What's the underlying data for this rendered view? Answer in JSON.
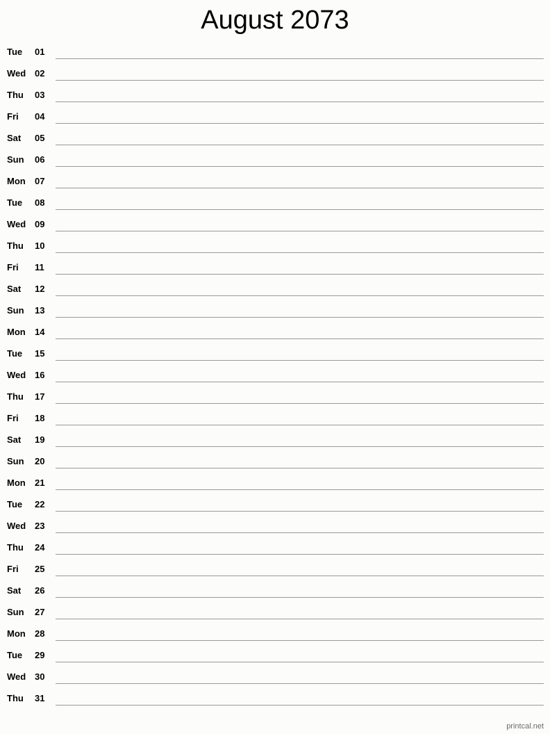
{
  "title": "August 2073",
  "days": [
    {
      "dow": "Tue",
      "num": "01"
    },
    {
      "dow": "Wed",
      "num": "02"
    },
    {
      "dow": "Thu",
      "num": "03"
    },
    {
      "dow": "Fri",
      "num": "04"
    },
    {
      "dow": "Sat",
      "num": "05"
    },
    {
      "dow": "Sun",
      "num": "06"
    },
    {
      "dow": "Mon",
      "num": "07"
    },
    {
      "dow": "Tue",
      "num": "08"
    },
    {
      "dow": "Wed",
      "num": "09"
    },
    {
      "dow": "Thu",
      "num": "10"
    },
    {
      "dow": "Fri",
      "num": "11"
    },
    {
      "dow": "Sat",
      "num": "12"
    },
    {
      "dow": "Sun",
      "num": "13"
    },
    {
      "dow": "Mon",
      "num": "14"
    },
    {
      "dow": "Tue",
      "num": "15"
    },
    {
      "dow": "Wed",
      "num": "16"
    },
    {
      "dow": "Thu",
      "num": "17"
    },
    {
      "dow": "Fri",
      "num": "18"
    },
    {
      "dow": "Sat",
      "num": "19"
    },
    {
      "dow": "Sun",
      "num": "20"
    },
    {
      "dow": "Mon",
      "num": "21"
    },
    {
      "dow": "Tue",
      "num": "22"
    },
    {
      "dow": "Wed",
      "num": "23"
    },
    {
      "dow": "Thu",
      "num": "24"
    },
    {
      "dow": "Fri",
      "num": "25"
    },
    {
      "dow": "Sat",
      "num": "26"
    },
    {
      "dow": "Sun",
      "num": "27"
    },
    {
      "dow": "Mon",
      "num": "28"
    },
    {
      "dow": "Tue",
      "num": "29"
    },
    {
      "dow": "Wed",
      "num": "30"
    },
    {
      "dow": "Thu",
      "num": "31"
    }
  ],
  "footer": "printcal.net"
}
